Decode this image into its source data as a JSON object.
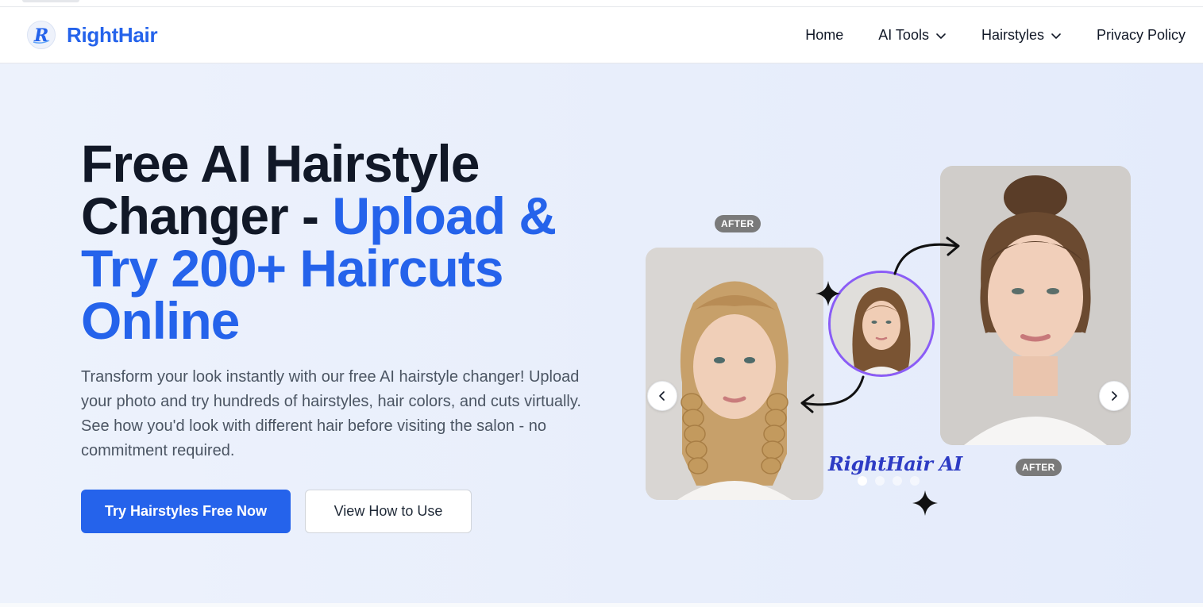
{
  "header": {
    "brand": "RightHair",
    "nav": [
      {
        "label": "Home",
        "has_dropdown": false
      },
      {
        "label": "AI Tools",
        "has_dropdown": true
      },
      {
        "label": "Hairstyles",
        "has_dropdown": true
      },
      {
        "label": "Privacy Policy",
        "has_dropdown": false
      }
    ]
  },
  "hero": {
    "title_part1": "Free AI Hairstyle Changer - ",
    "title_part2": "Upload & Try 200+ Haircuts Online",
    "description": "Transform your look instantly with our free AI hairstyle changer! Upload your photo and try hundreds of hairstyles, hair colors, and cuts virtually. See how you'd look with different hair before visiting the salon - no commitment required.",
    "primary_cta": "Try Hairstyles Free Now",
    "secondary_cta": "View How to Use"
  },
  "carousel": {
    "badge_top": "AFTER",
    "badge_bottom": "AFTER",
    "watermark": "RightHair AI",
    "slide_count": 4,
    "active_slide": 1
  },
  "colors": {
    "accent": "#2563eb",
    "title_dark": "#111827",
    "hero_bg": "#e8eefb",
    "badge": "#7a7a7a"
  },
  "icons": [
    "righthair-logo-icon",
    "chevron-down-icon",
    "sparkle-icon",
    "curved-arrow-icon",
    "chevron-left-icon",
    "chevron-right-icon"
  ]
}
